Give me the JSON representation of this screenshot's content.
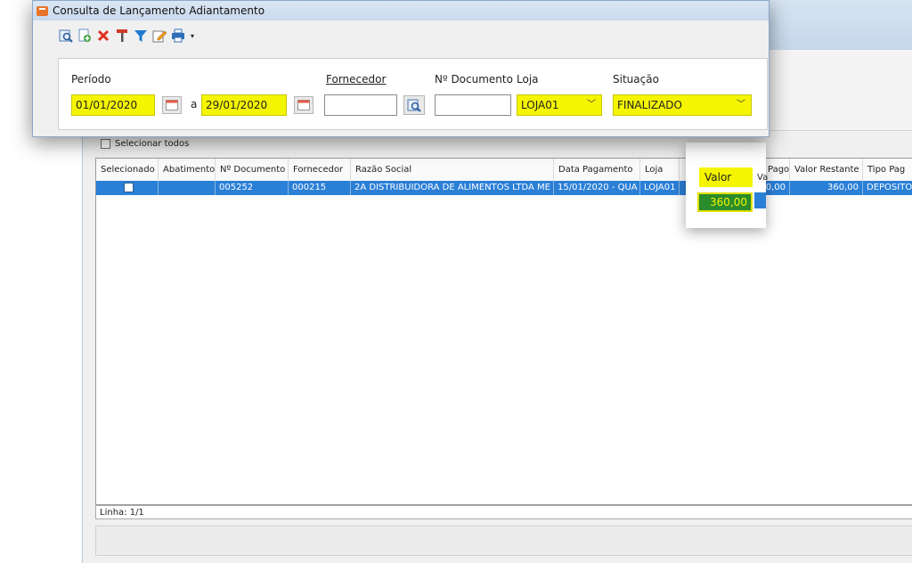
{
  "dialog": {
    "title": "Consulta de Lançamento Adiantamento",
    "icons": [
      "search-icon",
      "add-doc-icon",
      "delete-icon",
      "paint-icon",
      "filter-icon",
      "edit-icon",
      "print-icon"
    ]
  },
  "filters": {
    "periodo_label": "Período",
    "date_from": "01/01/2020",
    "separator": "a",
    "date_to": "29/01/2020",
    "fornecedor_label": "Fornecedor",
    "fornecedor_value": "",
    "documento_label": "Nº Documento",
    "documento_value": "",
    "loja_label": "Loja",
    "loja_value": "LOJA01",
    "situacao_label": "Situação",
    "situacao_value": "FINALIZADO"
  },
  "grid": {
    "select_all_label": "Selecionar todos",
    "columns": [
      "Selecionado",
      "Abatimento",
      "Nº Documento",
      "Fornecedor",
      "Razão Social",
      "Data Pagamento",
      "Loja",
      "Valor",
      "Va",
      "Pago",
      "Valor Restante",
      "Tipo Pag"
    ],
    "row": {
      "abatimento": "",
      "documento": "005252",
      "fornecedor": "000215",
      "razao_social": "2A DISTRIBUIDORA DE ALIMENTOS LTDA ME",
      "data_pagamento": "15/01/2020 - QUA",
      "loja": "LOJA01",
      "valor": "360,00",
      "pago": "0,00",
      "valor_restante": "360,00",
      "tipo_pag": "DEPOSITO"
    },
    "status": "Linha: 1/1"
  },
  "colors": {
    "highlight": "#f5f500",
    "selection": "#2a7fd6",
    "valor_bg": "#2a8c2a"
  }
}
